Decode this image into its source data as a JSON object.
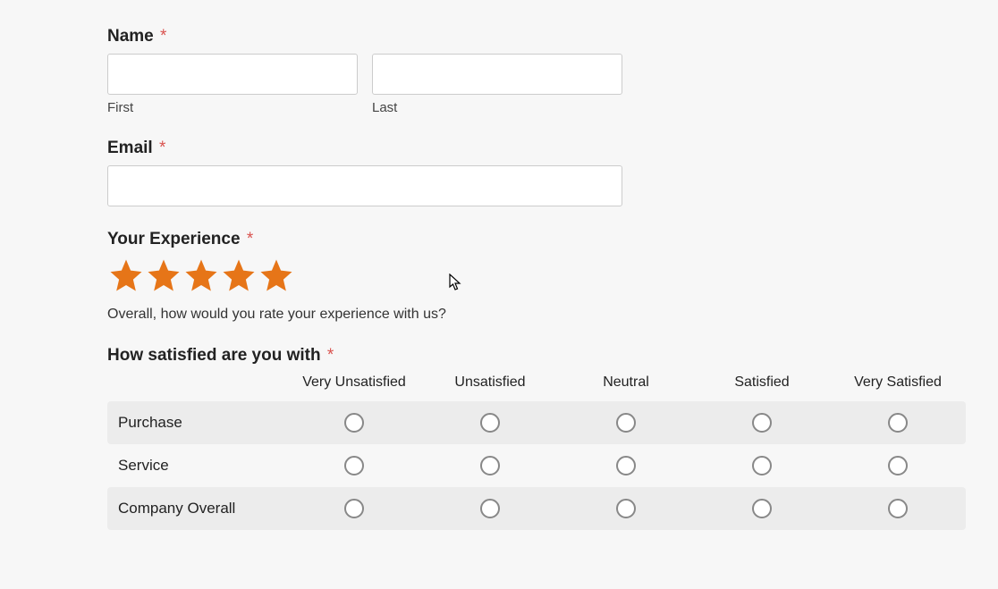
{
  "name": {
    "label": "Name",
    "first_sublabel": "First",
    "last_sublabel": "Last",
    "first_value": "",
    "last_value": ""
  },
  "email": {
    "label": "Email",
    "value": ""
  },
  "experience": {
    "label": "Your Experience",
    "help": "Overall, how would you rate your experience with us?",
    "rating": 5
  },
  "satisfaction": {
    "label": "How satisfied are you with",
    "columns": [
      "Very Unsatisfied",
      "Unsatisfied",
      "Neutral",
      "Satisfied",
      "Very Satisfied"
    ],
    "rows": [
      "Purchase",
      "Service",
      "Company Overall"
    ]
  },
  "required_marker": "*"
}
